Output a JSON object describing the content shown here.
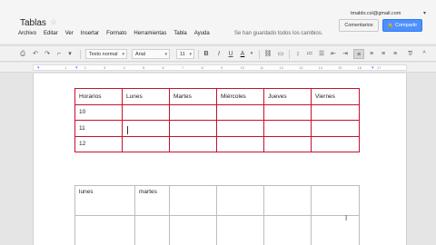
{
  "app": {
    "doc_title": "Tablas",
    "user_email": "tmaldo.csl@gmail.com",
    "save_status": "Se han guardado todos los cambios."
  },
  "menu": [
    "Archivo",
    "Editar",
    "Ver",
    "Insertar",
    "Formato",
    "Herramientas",
    "Tabla",
    "Ayuda"
  ],
  "buttons": {
    "comments": "Comentarios",
    "share": "Compartir"
  },
  "toolbar": {
    "style": "Texto normal",
    "font": "Arial",
    "size": "11",
    "bold": "B",
    "italic": "I",
    "underline": "U",
    "text_color": "A"
  },
  "ruler": {
    "numbers": [
      "1",
      "2",
      "3",
      "4",
      "5",
      "6",
      "7",
      "8",
      "9",
      "10",
      "11",
      "12",
      "13",
      "14",
      "15",
      "16",
      "17"
    ]
  },
  "table1": {
    "border_color": "#c8102e",
    "headers": [
      "Horarios",
      "Lunes",
      "Martes",
      "Miércoles",
      "Jueves",
      "Viernes"
    ],
    "rows": [
      [
        "10",
        "",
        "",
        "",
        "",
        ""
      ],
      [
        "11",
        "",
        "",
        "",
        "",
        ""
      ],
      [
        "12",
        "",
        "",
        "",
        "",
        ""
      ]
    ]
  },
  "table2": {
    "rows": [
      [
        "lunes",
        "martes",
        "",
        "",
        "",
        ""
      ],
      [
        "",
        "",
        "",
        "",
        "",
        ""
      ]
    ]
  },
  "colors": {
    "share_button": "#4d90fe",
    "table_border": "#c8102e"
  }
}
